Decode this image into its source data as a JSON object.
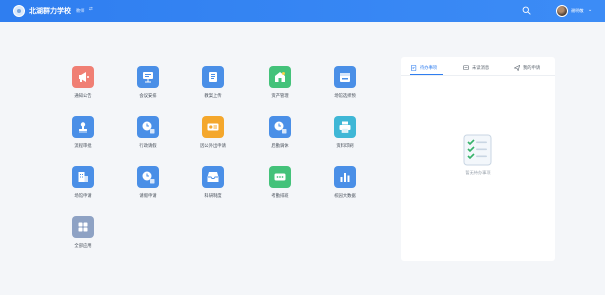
{
  "header": {
    "school_name": "北湖群力学校",
    "role_label": "教师",
    "role_switch_glyph": "⇄",
    "username": "谢明敬",
    "search_icon": "search-icon",
    "caret_glyph": "⌄",
    "colors": {
      "bar_start": "#2f7ef0",
      "bar_end": "#3c8cf6"
    }
  },
  "apps": [
    {
      "label": "通知公告",
      "icon": "megaphone-icon",
      "color": "#f07f74"
    },
    {
      "label": "会议安排",
      "icon": "meeting-board-icon",
      "color": "#4a8fe7"
    },
    {
      "label": "教案上传",
      "icon": "lesson-book-icon",
      "color": "#4a8fe7"
    },
    {
      "label": "资产管理",
      "icon": "asset-building-icon",
      "color": "#44c27a"
    },
    {
      "label": "场馆选择预",
      "icon": "venue-calendar-icon",
      "color": "#4a8fe7"
    },
    {
      "label": "流程审批",
      "icon": "stamp-icon",
      "color": "#4a8fe7"
    },
    {
      "label": "行政请假",
      "icon": "clock-doc-icon",
      "color": "#4a8fe7"
    },
    {
      "label": "因公外出申请",
      "icon": "id-card-icon",
      "color": "#f4a72c"
    },
    {
      "label": "后勤调休",
      "icon": "clock-doc-icon",
      "color": "#4a8fe7"
    },
    {
      "label": "资料印刷",
      "icon": "printer-icon",
      "color": "#3fb7d6"
    },
    {
      "label": "场馆申请",
      "icon": "building-icon",
      "color": "#4a8fe7"
    },
    {
      "label": "请假申请",
      "icon": "clock-doc-icon",
      "color": "#4a8fe7"
    },
    {
      "label": "科研制度",
      "icon": "inbox-tray-icon",
      "color": "#4a8fe7"
    },
    {
      "label": "考勤排班",
      "icon": "ellipsis-card-icon",
      "color": "#44c27a"
    },
    {
      "label": "校园大数据",
      "icon": "bar-chart-icon",
      "color": "#4a8fe7"
    },
    {
      "label": "全部应用",
      "icon": "grid-apps-icon",
      "color": "#8ea2c4"
    }
  ],
  "panel": {
    "tabs": [
      {
        "label": "待办事项",
        "icon": "todo-edit-icon"
      },
      {
        "label": "未读消息",
        "icon": "message-icon"
      },
      {
        "label": "我的申请",
        "icon": "send-icon"
      }
    ],
    "empty_text": "暂无待办事项",
    "accent": "#2f7ef0"
  }
}
